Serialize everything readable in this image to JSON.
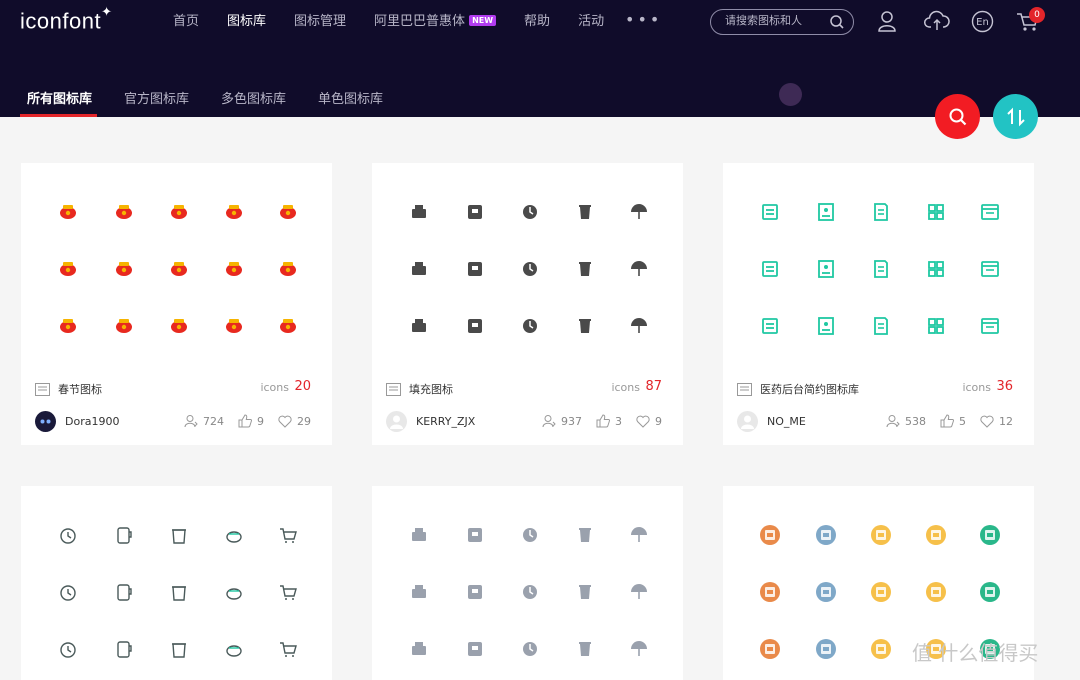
{
  "logo": "iconfont",
  "nav": [
    {
      "label": "首页",
      "active": false
    },
    {
      "label": "图标库",
      "active": true
    },
    {
      "label": "图标管理",
      "active": false
    },
    {
      "label": "阿里巴巴普惠体",
      "badge": "NEW",
      "active": false
    },
    {
      "label": "帮助",
      "active": false
    },
    {
      "label": "活动",
      "active": false
    }
  ],
  "nav_more": "•••",
  "search": {
    "placeholder": "请搜索图标和人"
  },
  "header_icons": [
    "user-icon",
    "upload-cloud-icon",
    "language-en-icon",
    "cart-icon"
  ],
  "language_label": "En",
  "cart_count": "0",
  "subnav": [
    {
      "label": "所有图标库",
      "active": true
    },
    {
      "label": "官方图标库",
      "active": false
    },
    {
      "label": "多色图标库",
      "active": false
    },
    {
      "label": "单色图标库",
      "active": false
    }
  ],
  "fabs": [
    "search-icon",
    "sort-icon"
  ],
  "colors": {
    "header_bg": "#100c2a",
    "accent": "#e3252a",
    "teal": "#22c3c4",
    "mint": "#1fc8a2",
    "gray_icon": "#4a4a4a",
    "slate_icon": "#9aa1ad"
  },
  "cards": [
    {
      "title": "春节图标",
      "icons_label": "icons",
      "count": "20",
      "author": "Dora1900",
      "views": "724",
      "likes": "9",
      "favorites": "29",
      "icon_style": "festive",
      "icon_color": "#e8291f",
      "icons": [
        "crab-icon",
        "teapot-icon",
        "hotpot-icon",
        "firecracker-icon",
        "lantern-icon",
        "fu-diamond-icon",
        "ingot-icon",
        "red-envelope-box-icon",
        "target-icon",
        "money-bag-icon",
        "lion-dance-icon",
        "red-packets-icon",
        "hat-icon",
        "rooster-icon",
        "firework-icon"
      ]
    },
    {
      "title": "填充图标",
      "icons_label": "icons",
      "count": "87",
      "author": "KERRY_ZJX",
      "views": "937",
      "likes": "3",
      "favorites": "9",
      "icon_style": "filled",
      "icon_color": "#4a4a4a",
      "icons": [
        "bed-icon",
        "photo-frame-icon",
        "boots-icon",
        "bottle-icon",
        "perfume-icon",
        "24h-icon",
        "cup-icon",
        "necklace-icon",
        "lipstick-icon",
        "toaster-icon",
        "cart-icon",
        "moon-icon",
        "bag-icon",
        "card-icon",
        "umbrella-icon"
      ]
    },
    {
      "title": "医药后台简约图标库",
      "icons_label": "icons",
      "count": "36",
      "author": "NO_ME",
      "views": "538",
      "likes": "5",
      "favorites": "12",
      "icon_style": "outline",
      "icon_color": "#1fc8a2",
      "icons": [
        "inbox-icon",
        "contact-card-icon",
        "document-check-icon",
        "files-icon",
        "server-icon",
        "monitor-icon",
        "building-icon",
        "id-list-icon",
        "apps-grid-icon",
        "calendar-icon",
        "checklist-icon",
        "report-icon",
        "shield-check-icon",
        "book-icon",
        "plus-circle-icon"
      ]
    },
    {
      "title": "",
      "icon_style": "line",
      "icon_color": "#4a5a5a",
      "icons": [
        "alarm-clock-icon",
        "mug-icon",
        "trash-icon",
        "pot-icon",
        "cart-icon",
        "play-circle-icon",
        "washer-icon",
        "cloudy-icon",
        "bulb-icon",
        "bowl-icon",
        "lamp-icon",
        "headphones-icon",
        "basketball-icon",
        "air-conditioner-icon",
        "shower-icon"
      ]
    },
    {
      "title": "",
      "icon_style": "filled",
      "icon_color": "#9aa1ad",
      "icons": [
        "widgets-icon",
        "wrench-icon",
        "graduation-cap-icon",
        "list-doc-icon",
        "lock-icon",
        "location-pin-icon",
        "folder-upload-icon",
        "document-icon",
        "video-icon",
        "shield-check-icon",
        "play-icon",
        "hard-drive-icon",
        "bar-chart-icon",
        "tv-icon",
        "question-icon"
      ]
    },
    {
      "title": "",
      "icon_style": "colorful",
      "icon_color": "#e98a4a",
      "icons": [
        "photo-icon",
        "printer-icon",
        "note-icon",
        "gear-icon",
        "calendar-icon",
        "search-icon",
        "phone-icon",
        "folder-icon",
        "card-icon",
        "chart-icon",
        "save-icon",
        "report-icon",
        "clipboard-icon",
        "settings-icon",
        "notebook-icon"
      ]
    }
  ],
  "watermark": "值 什么值得买"
}
